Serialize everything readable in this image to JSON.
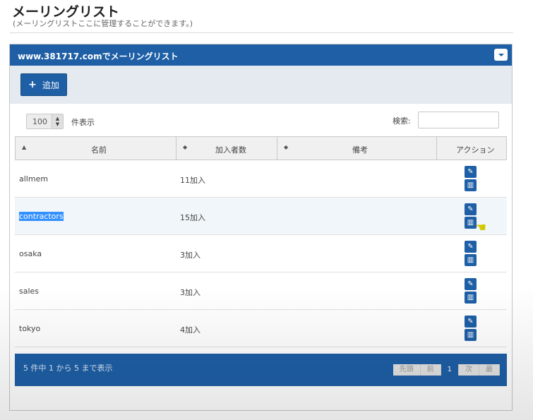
{
  "page": {
    "title": "メーリングリスト",
    "subtitle": "(メーリングリストここに管理することができます。)"
  },
  "panel": {
    "title": "www.381717.comでメーリングリスト",
    "add_label": "追加"
  },
  "controls": {
    "length_value": "100",
    "length_label": "件表示",
    "search_label": "検索:",
    "search_value": ""
  },
  "table": {
    "columns": [
      "名前",
      "加入者数",
      "備考",
      "アクション"
    ],
    "rows": [
      {
        "name": "allmem",
        "count": "11加入",
        "note": ""
      },
      {
        "name": "contractors",
        "count": "15加入",
        "note": ""
      },
      {
        "name": "osaka",
        "count": "3加入",
        "note": ""
      },
      {
        "name": "sales",
        "count": "3加入",
        "note": ""
      },
      {
        "name": "tokyo",
        "count": "4加入",
        "note": ""
      }
    ]
  },
  "footer": {
    "info": "5 件中 1 から 5 まで表示",
    "pager": [
      "先頭",
      "前",
      "1",
      "次",
      "最"
    ]
  },
  "colors": {
    "primary": "#1e5fa6",
    "selection": "#3390ff"
  },
  "icons": {
    "edit": "pencil-icon",
    "delete": "trash-icon",
    "add": "plus-icon",
    "collapse": "chevron-down-icon"
  }
}
